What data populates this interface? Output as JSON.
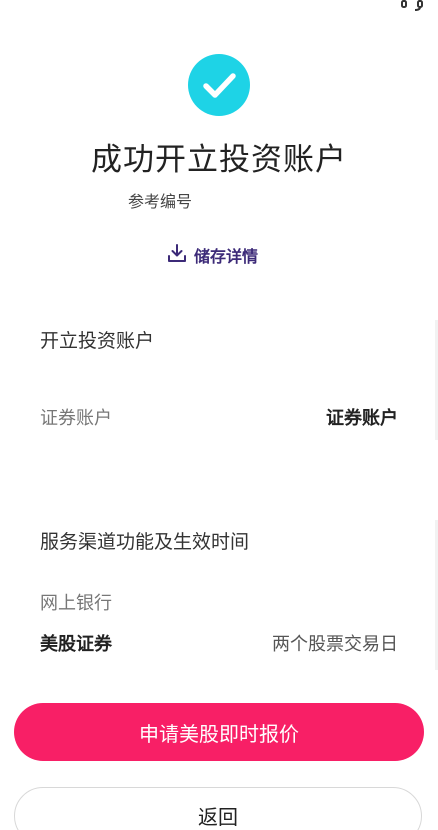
{
  "header": {
    "title": "成功开立投资账户",
    "reference_label": "参考编号",
    "save_details": "储存详情",
    "corner_icon": "support-headset-icon",
    "status_icon": "check-circle-icon"
  },
  "account_section": {
    "title": "开立投资账户",
    "rows": [
      {
        "label": "证券账户",
        "value": "证券账户"
      }
    ]
  },
  "service_section": {
    "title": "服务渠道功能及生效时间",
    "channel_label": "网上银行",
    "rows": [
      {
        "label": "美股证券",
        "value": "两个股票交易日"
      }
    ]
  },
  "actions": {
    "primary_label": "申请美股即时报价",
    "secondary_label": "返回"
  },
  "colors": {
    "accent_cyan": "#1ed3e6",
    "primary_button": "#f81f66",
    "link_purple": "#3c2a78"
  }
}
